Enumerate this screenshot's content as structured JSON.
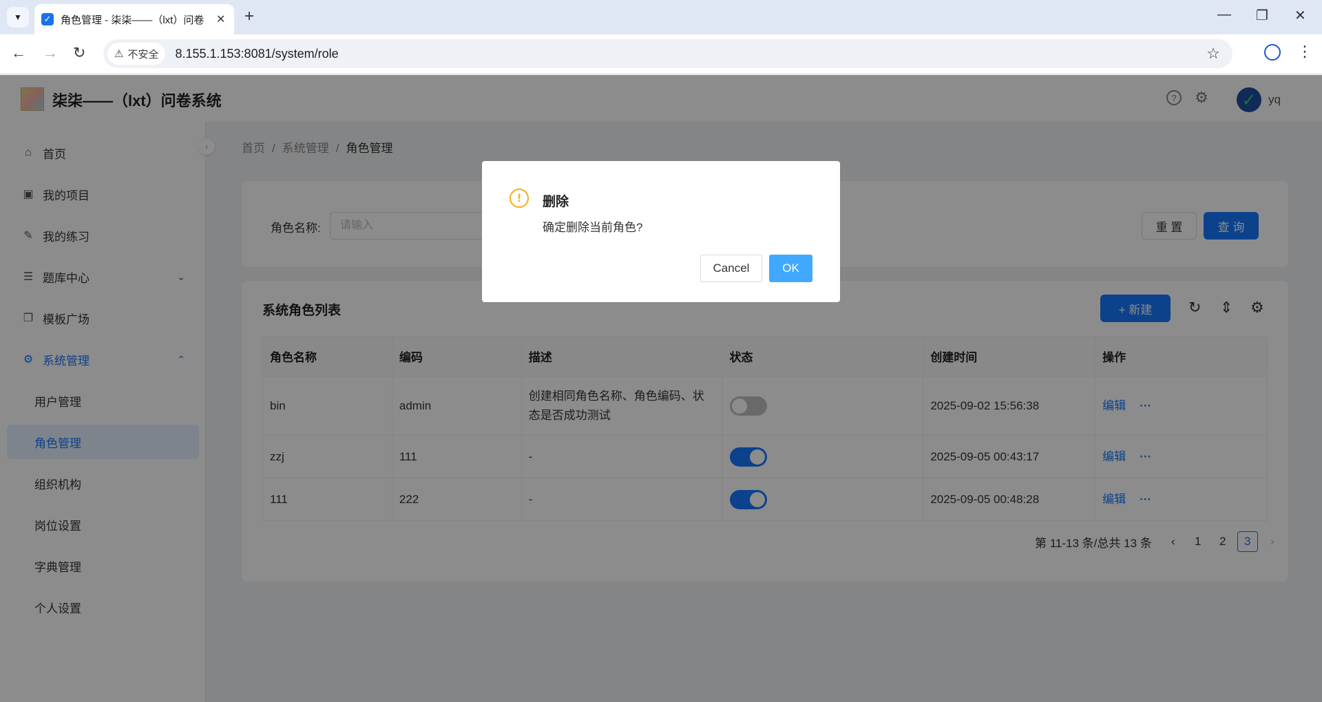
{
  "browser": {
    "tab_title": "角色管理 - 柒柒——（lxt）问卷",
    "security_label": "不安全",
    "url": "8.155.1.153:8081/system/role"
  },
  "app": {
    "title": "柒柒——（lxt）问卷系统",
    "username": "yq"
  },
  "sidebar": {
    "items": [
      {
        "label": "首页",
        "icon": "home-icon"
      },
      {
        "label": "我的项目",
        "icon": "project-icon"
      },
      {
        "label": "我的练习",
        "icon": "edit-icon"
      },
      {
        "label": "题库中心",
        "icon": "list-icon"
      },
      {
        "label": "模板广场",
        "icon": "copy-icon"
      },
      {
        "label": "系统管理",
        "icon": "gear-icon"
      }
    ],
    "sub_items": [
      {
        "label": "用户管理"
      },
      {
        "label": "角色管理"
      },
      {
        "label": "组织机构"
      },
      {
        "label": "岗位设置"
      },
      {
        "label": "字典管理"
      },
      {
        "label": "个人设置"
      }
    ]
  },
  "breadcrumb": {
    "items": [
      "首页",
      "系统管理",
      "角色管理"
    ]
  },
  "search": {
    "label": "角色名称:",
    "placeholder": "请输入",
    "reset_label": "重 置",
    "query_label": "查 询"
  },
  "table": {
    "title": "系统角色列表",
    "new_label": "+ 新建",
    "columns": [
      "角色名称",
      "编码",
      "描述",
      "状态",
      "创建时间",
      "操作"
    ],
    "rows": [
      {
        "name": "bin",
        "code": "admin",
        "desc": "创建相同角色名称、角色编码、状态是否成功测试",
        "enabled": false,
        "created": "2025-09-02 15:56:38",
        "edit": "编辑",
        "more": "···"
      },
      {
        "name": "zzj",
        "code": "111",
        "desc": "-",
        "enabled": true,
        "created": "2025-09-05 00:43:17",
        "edit": "编辑",
        "more": "···"
      },
      {
        "name": "111",
        "code": "222",
        "desc": "-",
        "enabled": true,
        "created": "2025-09-05 00:48:28",
        "edit": "编辑",
        "more": "···"
      }
    ]
  },
  "pagination": {
    "summary": "第 11-13 条/总共 13 条",
    "pages": [
      "1",
      "2",
      "3"
    ],
    "current": "3"
  },
  "modal": {
    "title": "删除",
    "content": "确定删除当前角色?",
    "cancel_label": "Cancel",
    "ok_label": "OK"
  }
}
